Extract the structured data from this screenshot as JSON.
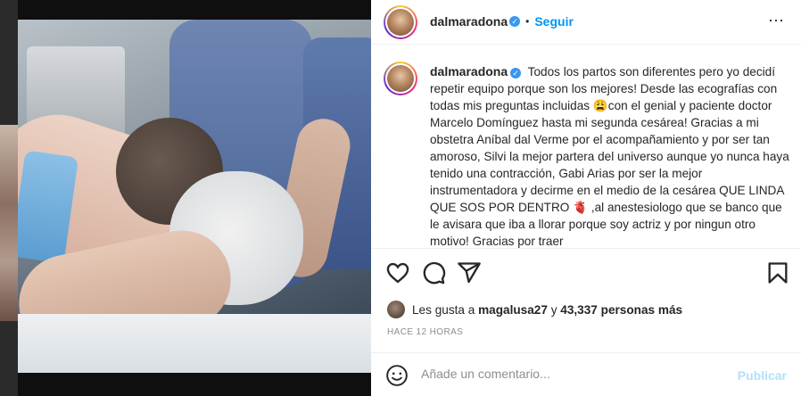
{
  "post": {
    "username": "dalmaradona",
    "verified_icon": "verified-badge-icon",
    "dot": "•",
    "follow_label": "Seguir",
    "more_icon": "more-options-icon",
    "more_glyph": "⋯"
  },
  "caption": {
    "username": "dalmaradona",
    "text": "Todos los partos son diferentes pero yo decidí repetir equipo porque son los mejores! Desde las ecografías con todas mis preguntas incluidas 😩con el genial y paciente doctor Marcelo Domínguez hasta mi segunda cesárea! Gracias a mi obstetra Aníbal dal Verme por el acompañamiento y por ser tan amoroso, Silvi la mejor partera del universo aunque yo nunca haya tenido una contracción, Gabi Arias por ser la mejor instrumentadora y decirme en el medio de la cesárea QUE LINDA QUE SOS POR DENTRO 🫀 ,al anestesiologo que se banco que le avisara que iba a llorar porque soy actriz y por ningun otro motivo! Gracias por traer"
  },
  "actions": {
    "like_icon": "heart-icon",
    "comment_icon": "comment-icon",
    "share_icon": "share-icon",
    "save_icon": "bookmark-icon"
  },
  "likes": {
    "prefix": "Les gusta a",
    "user": "magalusa27",
    "connector": "y",
    "count": "43,337 personas más"
  },
  "timestamp": "HACE 12 HORAS",
  "comment_box": {
    "emoji_icon": "emoji-icon",
    "placeholder": "Añade un comentario...",
    "publish_label": "Publicar"
  },
  "colors": {
    "link_blue": "#0095f6",
    "publish_disabled": "#b2dffc",
    "verified_blue": "#3897f0"
  }
}
